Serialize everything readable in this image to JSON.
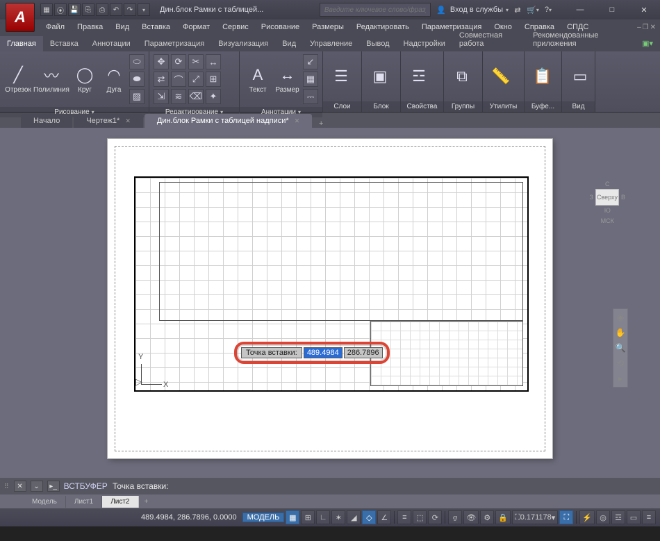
{
  "titlebar": {
    "doc_title": "Дин.блок Рамки с таблицей...",
    "search_placeholder": "Введите ключевое слово/фразу",
    "signin": "Вход в службы"
  },
  "menus": [
    "Файл",
    "Правка",
    "Вид",
    "Вставка",
    "Формат",
    "Сервис",
    "Рисование",
    "Размеры",
    "Редактировать",
    "Параметризация",
    "Окно",
    "Справка",
    "СПДС"
  ],
  "ribbon_tabs": [
    "Главная",
    "Вставка",
    "Аннотации",
    "Параметризация",
    "Визуализация",
    "Вид",
    "Управление",
    "Вывод",
    "Надстройки",
    "Совместная работа",
    "Рекомендованные приложения"
  ],
  "ribbon_active": 0,
  "panels": {
    "draw": {
      "title": "Рисование",
      "items": [
        "Отрезок",
        "Полилиния",
        "Круг",
        "Дуга"
      ]
    },
    "modify": {
      "title": "Редактирование"
    },
    "annot": {
      "title": "Аннотации",
      "items": [
        "Текст",
        "Размер"
      ]
    },
    "layers": {
      "title": "Слои"
    },
    "block": {
      "title": "Блок"
    },
    "props": {
      "title": "Свойства"
    },
    "groups": {
      "title": "Группы"
    },
    "utils": {
      "title": "Утилиты"
    },
    "clip": {
      "title": "Буфе..."
    },
    "view": {
      "title": "Вид"
    }
  },
  "doc_tabs": [
    {
      "label": "Начало",
      "active": false,
      "closable": false
    },
    {
      "label": "Чертеж1*",
      "active": false,
      "closable": true
    },
    {
      "label": "Дин.блок Рамки с таблицей надписи*",
      "active": true,
      "closable": true
    }
  ],
  "viewcube": {
    "n": "С",
    "s": "Ю",
    "w": "З",
    "e": "В",
    "top": "Сверху",
    "ucs": "МСК"
  },
  "dynamic_input": {
    "label": "Точка вставки:",
    "x": "489.4984",
    "y": "286.7896"
  },
  "cmdline": {
    "cmd": "ВСТБУФЕР",
    "prompt": "Точка вставки:"
  },
  "layout_tabs": [
    "Модель",
    "Лист1",
    "Лист2"
  ],
  "layout_active": 2,
  "status": {
    "coords": "489.4984, 286.7896, 0.0000",
    "model": "МОДЕЛЬ",
    "scale": "0.171178"
  },
  "ucs_axes": {
    "x": "X",
    "y": "Y"
  }
}
